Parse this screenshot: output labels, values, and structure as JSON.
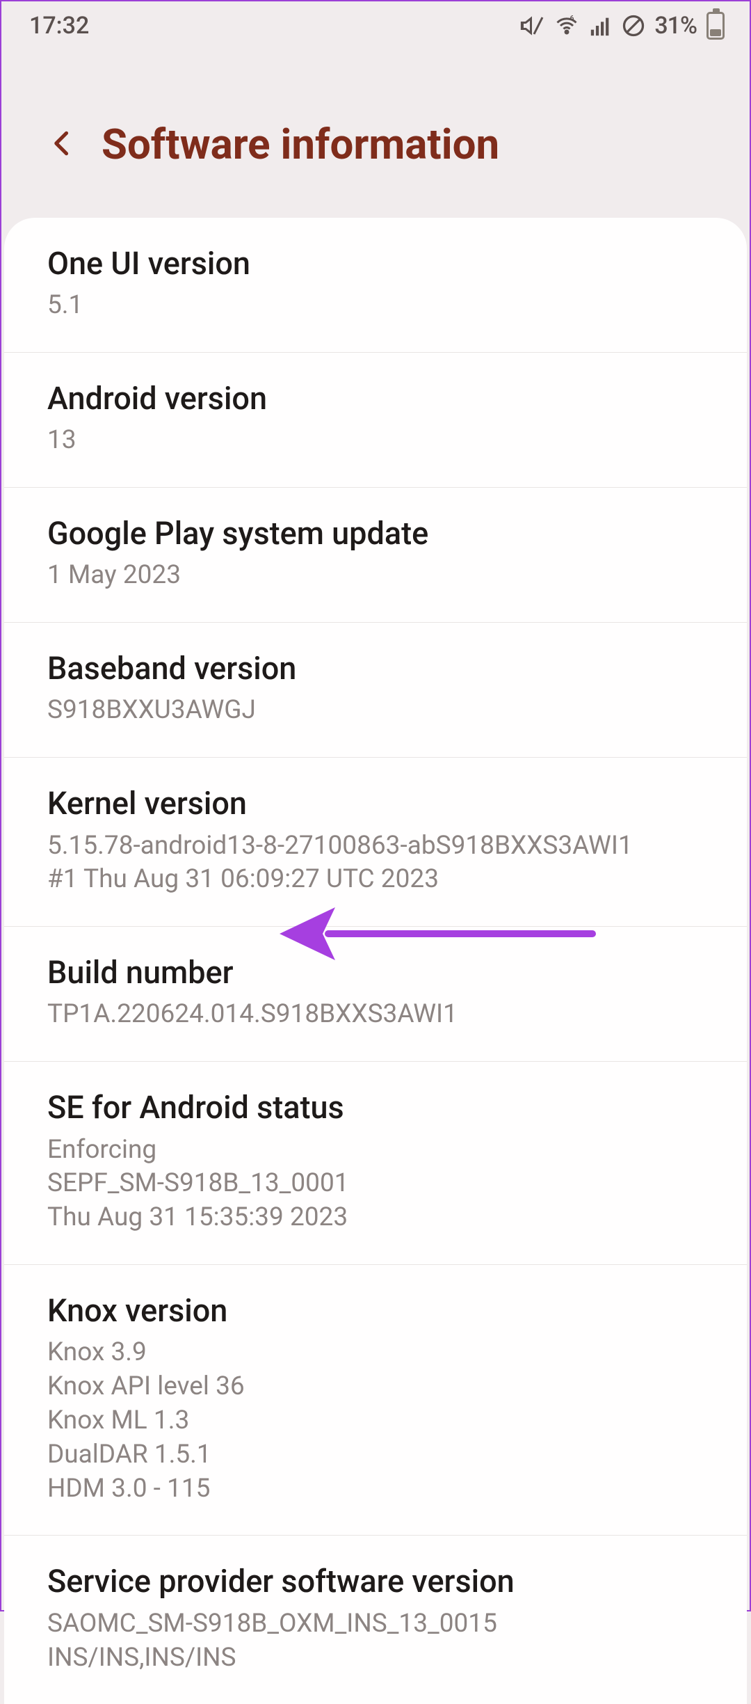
{
  "status": {
    "time": "17:32",
    "battery_pct": "31%"
  },
  "header": {
    "title": "Software information"
  },
  "items": [
    {
      "label": "One UI version",
      "value": "5.1"
    },
    {
      "label": "Android version",
      "value": "13"
    },
    {
      "label": "Google Play system update",
      "value": "1 May 2023"
    },
    {
      "label": "Baseband version",
      "value": "S918BXXU3AWGJ"
    },
    {
      "label": "Kernel version",
      "value": "5.15.78-android13-8-27100863-abS918BXXS3AWI1\n#1 Thu Aug 31 06:09:27 UTC 2023"
    },
    {
      "label": "Build number",
      "value": "TP1A.220624.014.S918BXXS3AWI1"
    },
    {
      "label": "SE for Android status",
      "value": "Enforcing\nSEPF_SM-S918B_13_0001\nThu Aug 31 15:35:39 2023"
    },
    {
      "label": "Knox version",
      "value": "Knox 3.9\nKnox API level 36\nKnox ML 1.3\nDualDAR 1.5.1\nHDM 3.0 - 115"
    },
    {
      "label": "Service provider software version",
      "value": "SAOMC_SM-S918B_OXM_INS_13_0015\nINS/INS,INS/INS"
    }
  ],
  "annotation": {
    "color": "#a63fe0"
  }
}
